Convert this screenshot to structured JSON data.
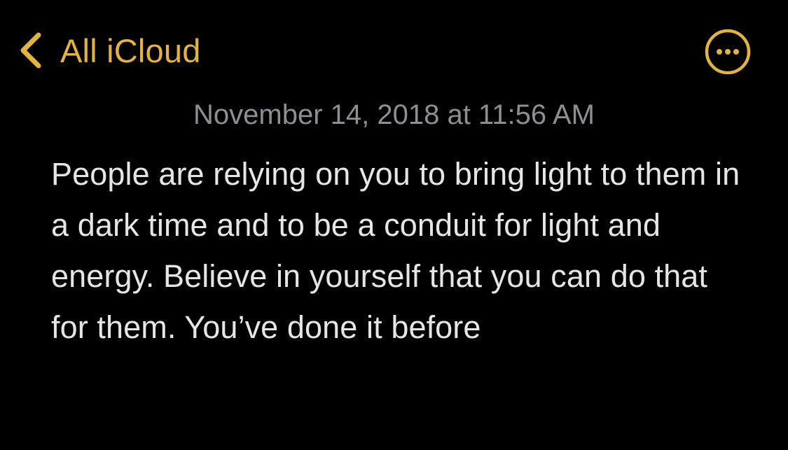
{
  "nav": {
    "back_label": "All iCloud",
    "back_icon": "chevron-left-icon",
    "more_icon": "ellipsis-circle-icon",
    "accent_color": "#E3B341"
  },
  "note": {
    "date": "November 14, 2018 at 11:56 AM",
    "body": "People are relying on you to bring light to them in a dark time and to be a conduit for light and energy. Believe in yourself that you can do that for them. You’ve done it before"
  },
  "colors": {
    "background": "#000000",
    "body_text": "#E5E5E5",
    "date_text": "#8E8E93"
  }
}
